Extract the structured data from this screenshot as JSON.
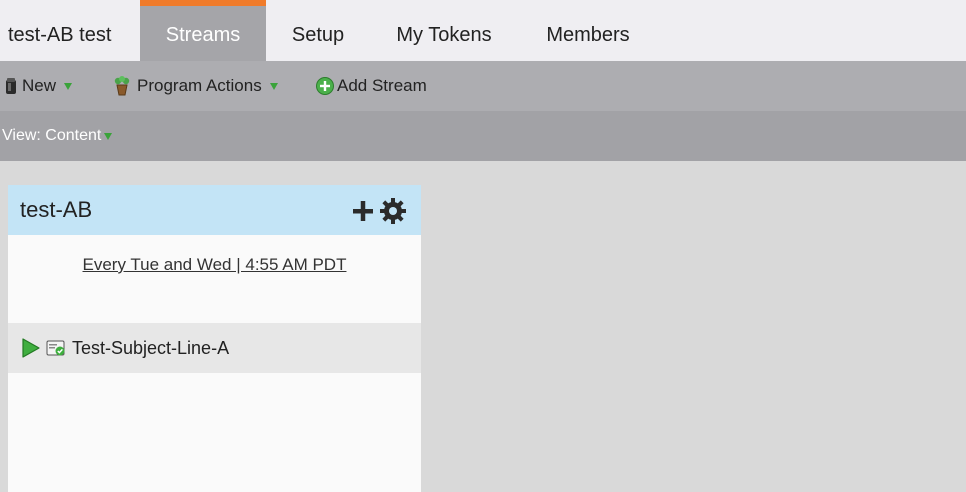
{
  "tabs": {
    "program": "test-AB test",
    "items": [
      {
        "label": "Streams",
        "active": true
      },
      {
        "label": "Setup",
        "active": false
      },
      {
        "label": "My Tokens",
        "active": false
      },
      {
        "label": "Members",
        "active": false
      }
    ]
  },
  "toolbar": {
    "new_label": "New",
    "program_actions_label": "Program Actions",
    "add_stream_label": "Add Stream"
  },
  "view": {
    "label": "View: Content"
  },
  "stream": {
    "title": "test-AB",
    "schedule": "Every Tue and Wed | 4:55 AM PDT",
    "content": [
      {
        "label": "Test-Subject-Line-A",
        "status_icon": "play-icon",
        "type_icon": "email-icon"
      }
    ]
  },
  "colors": {
    "active_tab_accent": "#f07b2a",
    "stream_header_bg": "#c3e4f6"
  }
}
